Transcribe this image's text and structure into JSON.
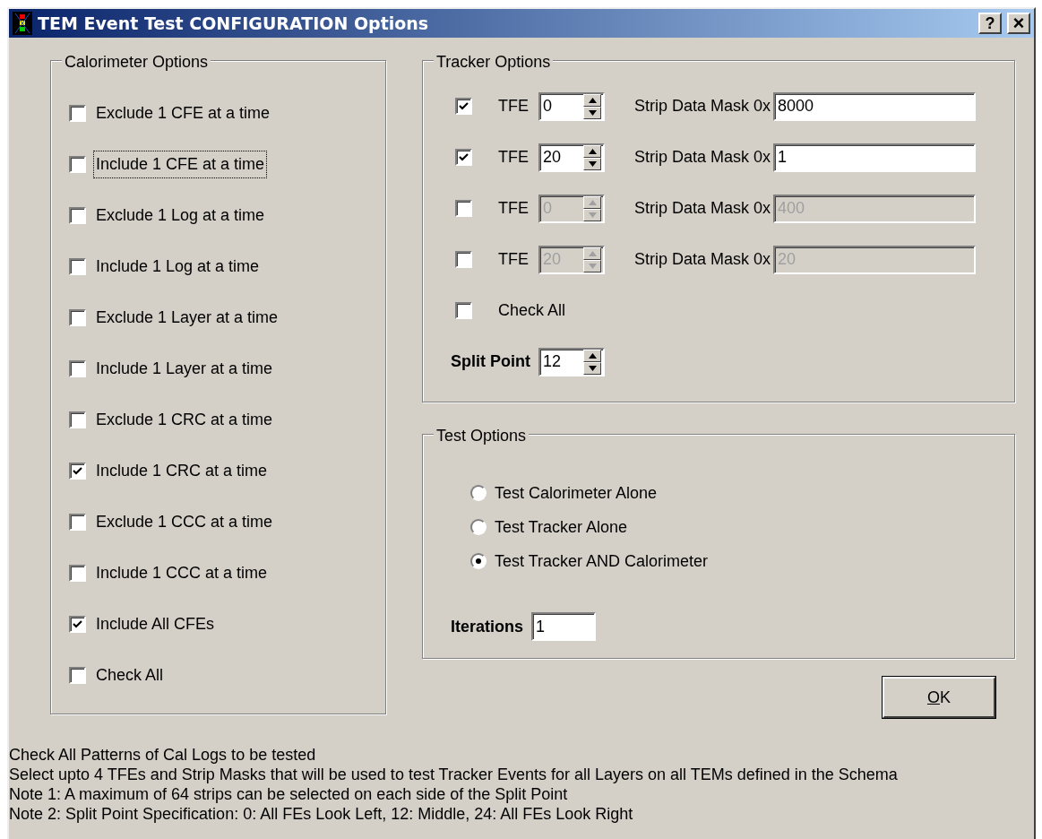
{
  "window": {
    "title": "TEM Event Test CONFIGURATION Options",
    "buttons": [
      {
        "kind": "help",
        "label": "?"
      },
      {
        "kind": "close",
        "label": "×"
      }
    ]
  },
  "calorimeter_options": {
    "title": "Calorimeter Options",
    "items": [
      {
        "label": "Exclude 1 CFE at a time",
        "checked": false,
        "focused": false
      },
      {
        "label": "Include 1 CFE at a time",
        "checked": false,
        "focused": true
      },
      {
        "label": "Exclude 1 Log at a time",
        "checked": false,
        "focused": false
      },
      {
        "label": "Include 1 Log at a time",
        "checked": false,
        "focused": false
      },
      {
        "label": "Exclude 1 Layer at a time",
        "checked": false,
        "focused": false
      },
      {
        "label": "Include 1 Layer at a time",
        "checked": false,
        "focused": false
      },
      {
        "label": "Exclude 1 CRC at a time",
        "checked": false,
        "focused": false
      },
      {
        "label": "Include 1 CRC at a time",
        "checked": true,
        "focused": false
      },
      {
        "label": "Exclude 1 CCC at a time",
        "checked": false,
        "focused": false
      },
      {
        "label": "Include 1 CCC at a time",
        "checked": false,
        "focused": false
      },
      {
        "label": "Include All CFEs",
        "checked": true,
        "focused": false
      },
      {
        "label": "Check All",
        "checked": false,
        "focused": false
      }
    ]
  },
  "tracker_options": {
    "title": "Tracker Options",
    "rows": [
      {
        "checked": true,
        "label": "TFE",
        "tfe": "0",
        "mask_label": "Strip Data Mask 0x",
        "mask": "8000",
        "disabled": false
      },
      {
        "checked": true,
        "label": "TFE",
        "tfe": "20",
        "mask_label": "Strip Data Mask 0x",
        "mask": "1",
        "disabled": false
      },
      {
        "checked": false,
        "label": "TFE",
        "tfe": "0",
        "mask_label": "Strip Data Mask 0x",
        "mask": "400",
        "disabled": true
      },
      {
        "checked": false,
        "label": "TFE",
        "tfe": "20",
        "mask_label": "Strip Data Mask 0x",
        "mask": "20",
        "disabled": true
      }
    ],
    "check_all": {
      "label": "Check All",
      "checked": false
    },
    "split_point": {
      "label": "Split Point",
      "value": "12"
    }
  },
  "test_options": {
    "title": "Test Options",
    "radios": [
      {
        "label": "Test Calorimeter Alone",
        "selected": false
      },
      {
        "label": "Test Tracker Alone",
        "selected": false
      },
      {
        "label": "Test Tracker AND Calorimeter",
        "selected": true
      }
    ],
    "iterations": {
      "label": "Iterations",
      "value": "1"
    }
  },
  "ok_button": {
    "label": "OK",
    "mnemonic_underlined": true
  },
  "notes": [
    "Check All Patterns of Cal Logs to be tested",
    "Select upto 4 TFEs and Strip Masks that will be used to test Tracker Events for all Layers on all TEMs defined in the Schema",
    "Note 1: A maximum of 64 strips can be selected on each side of the Split Point",
    "Note 2: Split Point Specification: 0: All FEs Look Left, 12: Middle, 24: All FEs Look Right"
  ]
}
